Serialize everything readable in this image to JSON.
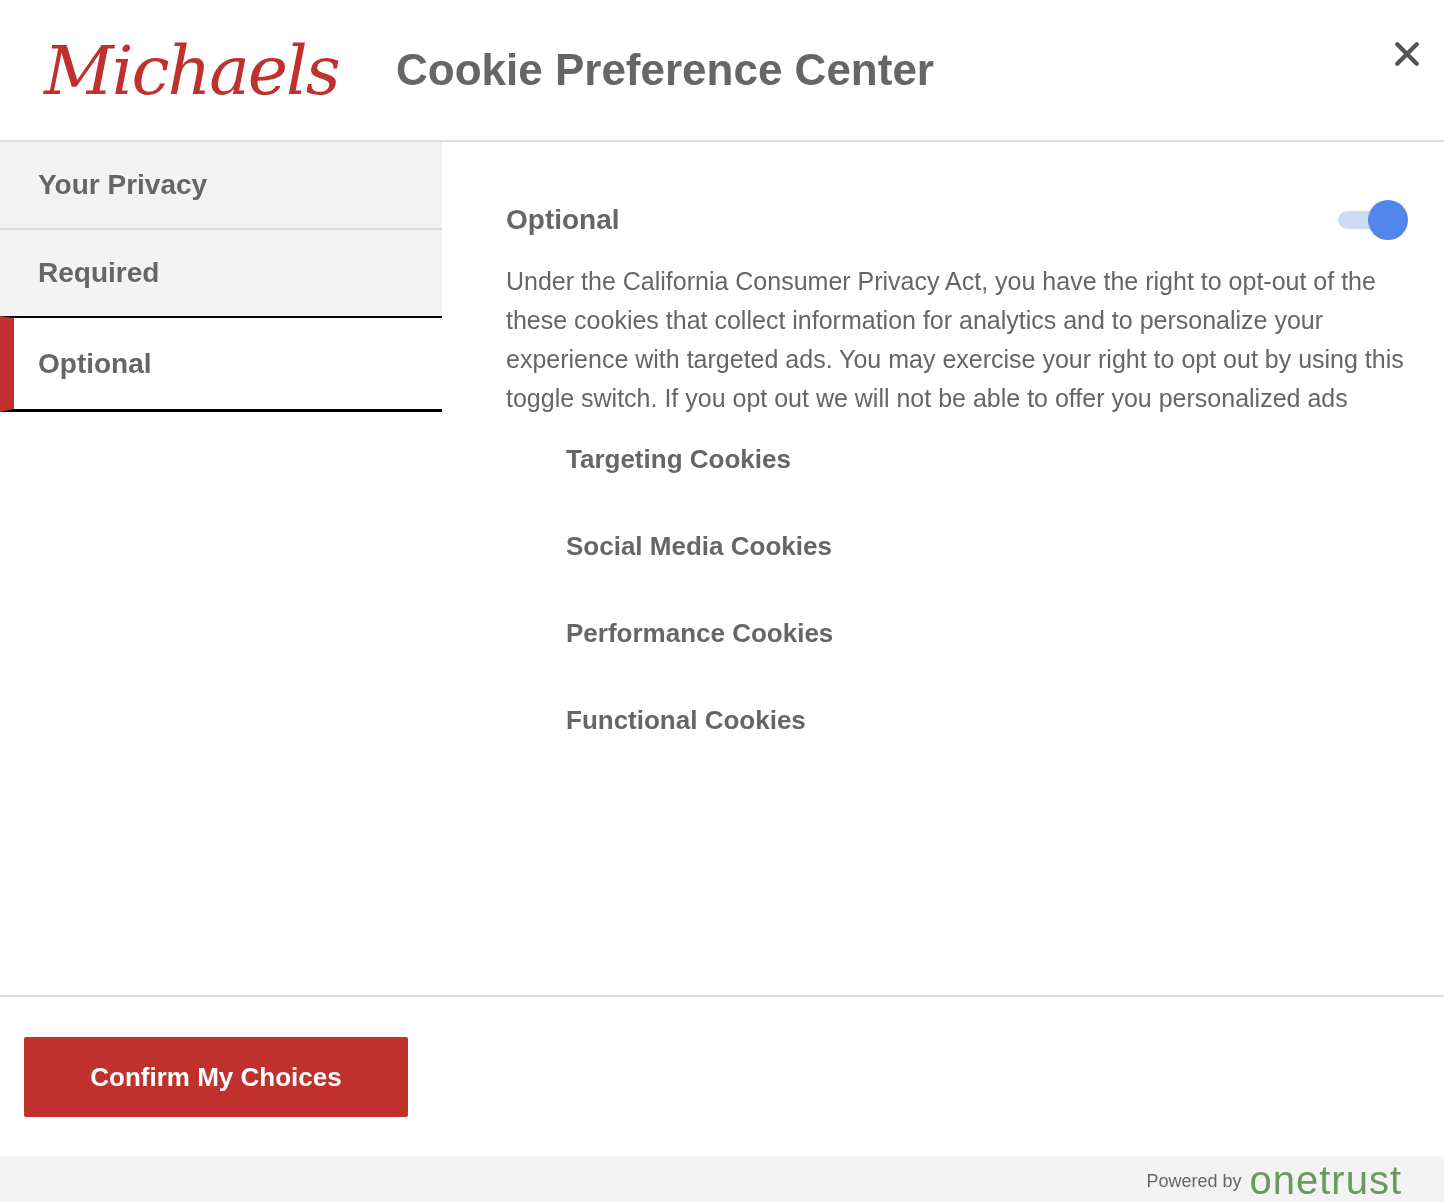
{
  "header": {
    "logo": "Michaels",
    "title": "Cookie Preference Center"
  },
  "tabs": [
    {
      "label": "Your Privacy",
      "selected": false
    },
    {
      "label": "Required",
      "selected": false
    },
    {
      "label": "Optional",
      "selected": true
    }
  ],
  "panel": {
    "heading": "Optional",
    "toggle_on": true,
    "description": "Under the California Consumer Privacy Act, you have the right to opt-out of the these cookies that collect information for analytics and to personalize your experience with targeted ads. You may exercise your right to opt out by using this toggle switch. If you opt out we will not be able to offer you personalized ads",
    "categories": [
      "Targeting Cookies",
      "Social Media Cookies",
      "Performance Cookies",
      "Functional Cookies"
    ]
  },
  "confirm_button": "Confirm My Choices",
  "footer": {
    "powered_by": "Powered by",
    "brand": "onetrust"
  }
}
